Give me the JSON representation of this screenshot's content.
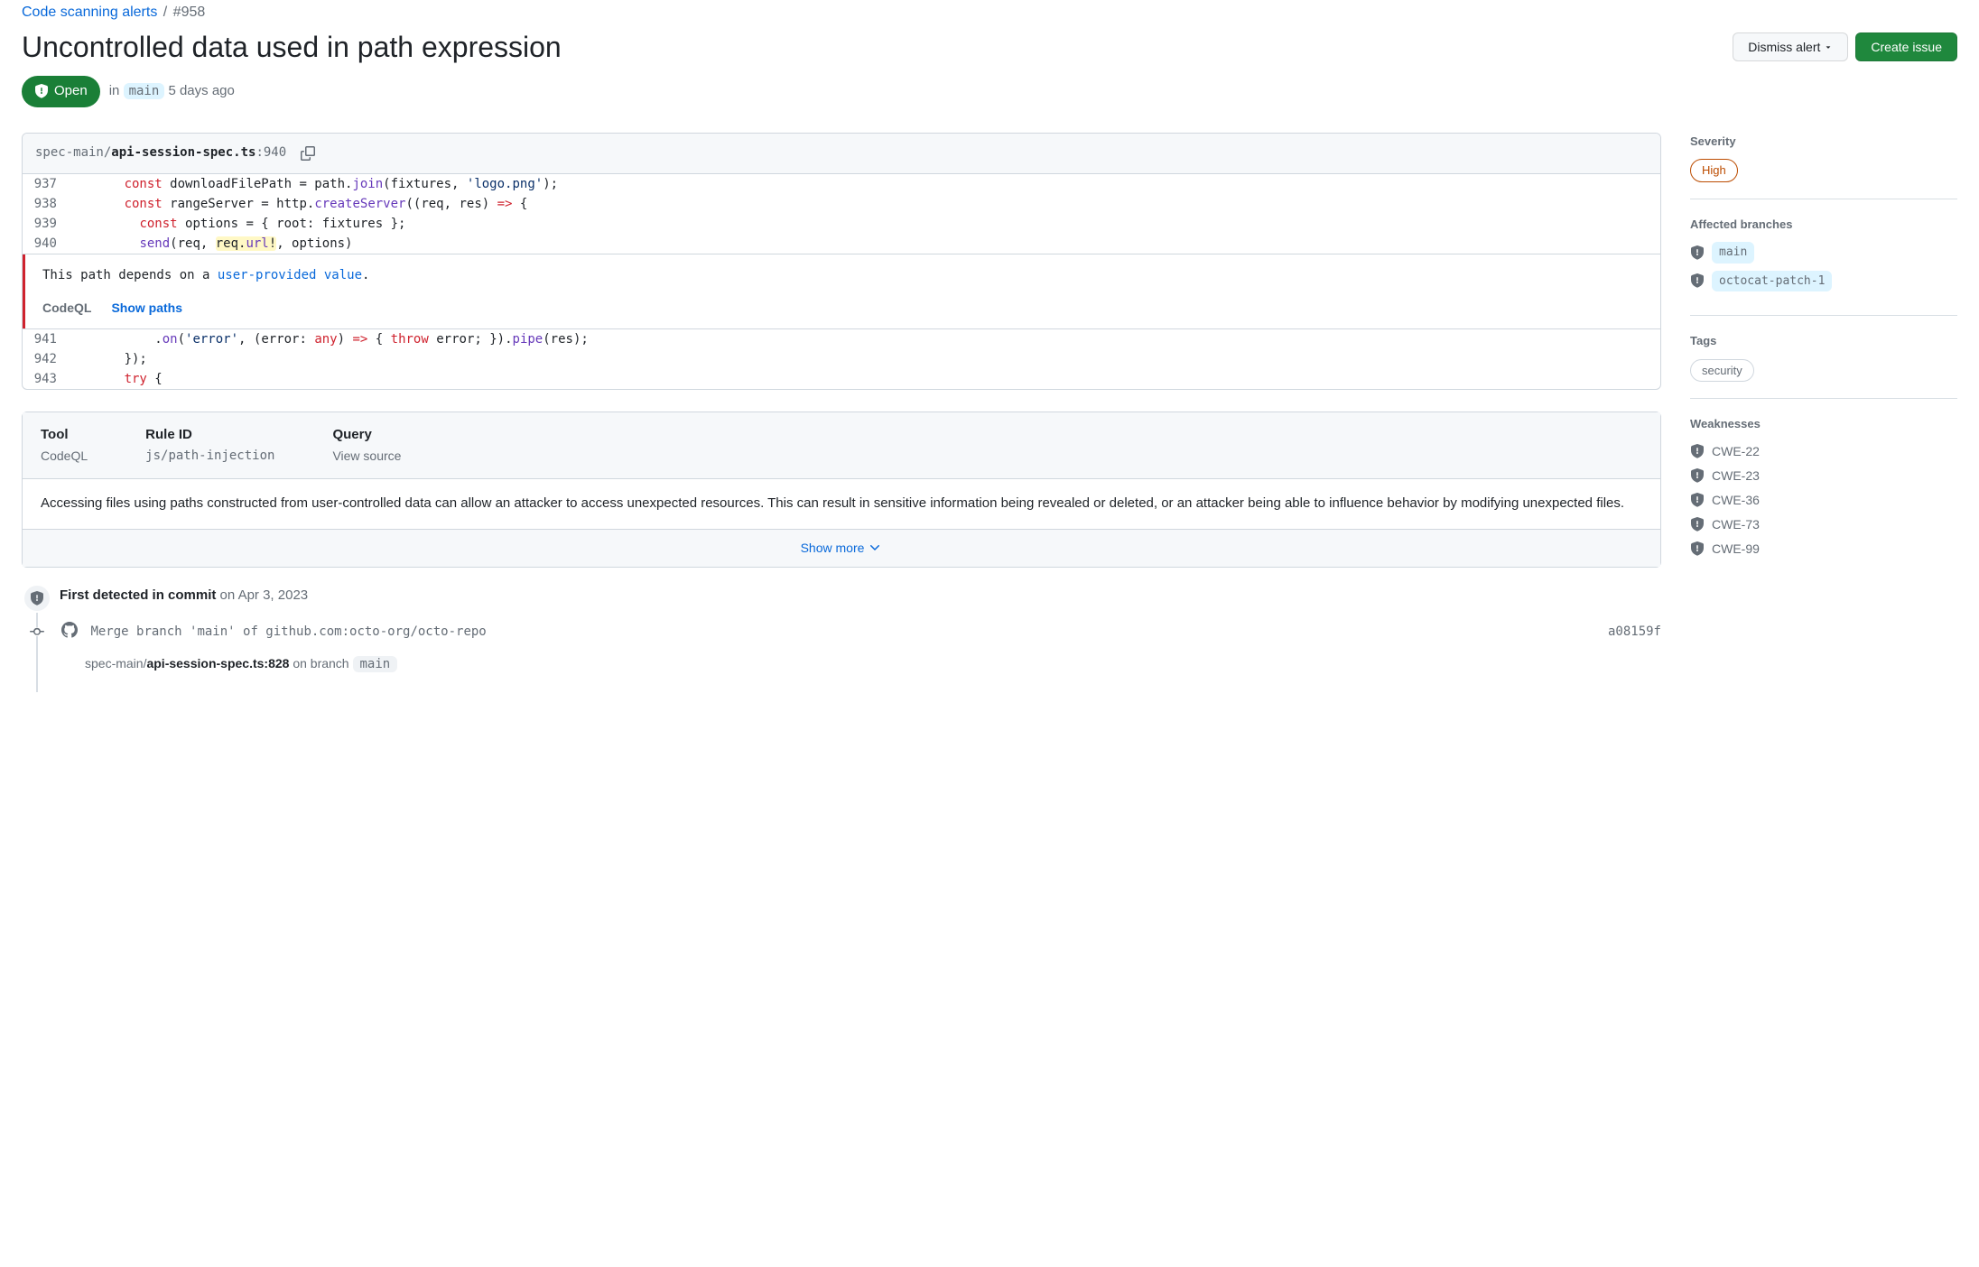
{
  "breadcrumb": {
    "parent": "Code scanning alerts",
    "sep": "/",
    "current": "#958"
  },
  "title": "Uncontrolled data used in path expression",
  "actions": {
    "dismiss": "Dismiss alert",
    "create_issue": "Create issue"
  },
  "status": {
    "state": "Open",
    "prefix": "in",
    "branch": "main",
    "age": "5 days ago"
  },
  "code": {
    "path_dir": "spec-main/",
    "path_file": "api-session-spec.ts",
    "line_suffix": ":940",
    "lines": {
      "l937": "937",
      "l938": "938",
      "l939": "939",
      "l940": "940",
      "l941": "941",
      "l942": "942",
      "l943": "943"
    }
  },
  "message": {
    "prefix": "This path depends on a ",
    "link": "user-provided value",
    "suffix": ".",
    "tool": "CodeQL",
    "show_paths": "Show paths"
  },
  "details": {
    "head": {
      "tool_label": "Tool",
      "tool_val": "CodeQL",
      "rule_label": "Rule ID",
      "rule_val": "js/path-injection",
      "query_label": "Query",
      "query_val": "View source"
    },
    "body": "Accessing files using paths constructed from user-controlled data can allow an attacker to access unexpected resources. This can result in sensitive information being revealed or deleted, or an attacker being able to influence behavior by modifying unexpected files.",
    "show_more": "Show more"
  },
  "timeline": {
    "first_detected_label": "First detected in commit",
    "first_detected_date": "on Apr 3, 2023",
    "commit_msg": "Merge branch 'main' of github.com:octo-org/octo-repo",
    "commit_sha": "a08159f",
    "loc_dir": "spec-main/",
    "loc_file": "api-session-spec.ts:828",
    "loc_on": "on branch",
    "loc_branch": "main"
  },
  "sidebar": {
    "severity_label": "Severity",
    "severity_val": "High",
    "branches_label": "Affected branches",
    "branches": [
      {
        "name": "main",
        "active": true
      },
      {
        "name": "octocat-patch-1",
        "active": true
      }
    ],
    "tags_label": "Tags",
    "tags": [
      "security"
    ],
    "weak_label": "Weaknesses",
    "weaknesses": [
      "CWE-22",
      "CWE-23",
      "CWE-36",
      "CWE-73",
      "CWE-99"
    ]
  }
}
